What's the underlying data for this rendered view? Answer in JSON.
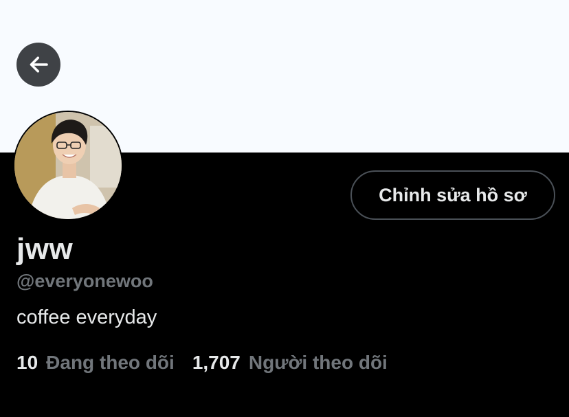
{
  "header": {
    "back_icon": "arrow-left-icon"
  },
  "profile": {
    "avatar": "avatar-photo",
    "edit_button_label": "Chỉnh sửa hồ sơ",
    "display_name": "jww",
    "handle": "@everyonewoo",
    "bio": "coffee everyday",
    "following_count": "10",
    "following_label": "Đang theo dõi",
    "followers_count": "1,707",
    "followers_label": "Người theo dõi"
  },
  "colors": {
    "background": "#000000",
    "banner": "#f8fbff",
    "primary_text": "#e7e9ea",
    "secondary_text": "#71767b",
    "button_border": "#4a5057",
    "back_button": "#3f4246"
  }
}
